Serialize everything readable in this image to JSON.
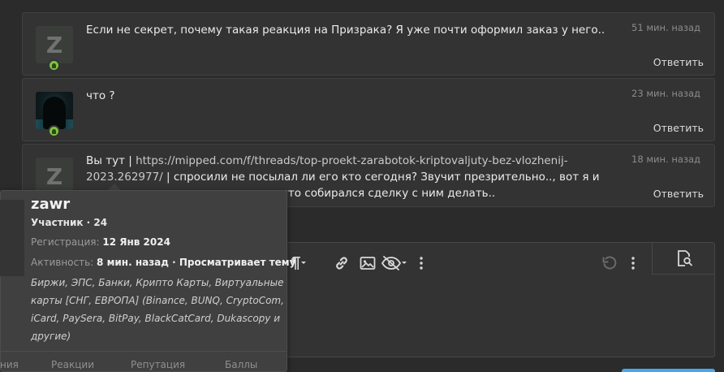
{
  "messages": [
    {
      "avatar": "z-letter-avatar",
      "text": "Если не секрет, почему такая реакция на Призрака? Я уже почти оформил заказ у него..",
      "time": "51 мин. назад",
      "reply": "Ответить"
    },
    {
      "avatar": "hooded-figure-avatar",
      "text": "что ?",
      "time": "23 мин. назад",
      "reply": "Ответить"
    },
    {
      "avatar": "z-letter-avatar",
      "text_prefix": "Вы тут | ",
      "link": "https://mipped.com/f/threads/top-proekt-zarabotok-kriptovaljuty-bez-vlozhenij-2023.262977/",
      "text_suffix": " | спросили не посылал ли его кто сегодня? Звучит презрительно.., вот я и спросил чем он так",
      "text_line3": "плох, потому что собирался сделку с ним делать..",
      "time": "18 мин. назад",
      "reply": "Ответить"
    }
  ],
  "avatar_letter": "Z",
  "tooltip": {
    "name": "zawr",
    "role": "Участник · 24",
    "reg_label": "Регистрация:",
    "reg_value": "12 Янв 2024",
    "activity_label": "Активность:",
    "activity_value": "8 мин. назад · Просматривает тему",
    "about": "Биржи, ЭПС, Банки, Крипто Карты, Виртуальные карты [СНГ, ЕВРОПА] (Binance, BUNQ, CryptoCom, iCard, PaySera, BitPay, BlackCatCard, Dukascopy и другие)",
    "stats": [
      "ния",
      "Реакции",
      "Репутация",
      "Баллы"
    ]
  },
  "editor": {
    "toolbar_icons": [
      "paragraph-icon",
      "link-icon",
      "image-icon",
      "hide-icon",
      "more-vertical-icon",
      "undo-icon",
      "more-vertical-icon",
      "preview-icon"
    ]
  },
  "colors": {
    "background": "#2b2b2b",
    "message_bg": "#333333",
    "online": "#7fc142",
    "button": "#47a7eb"
  }
}
